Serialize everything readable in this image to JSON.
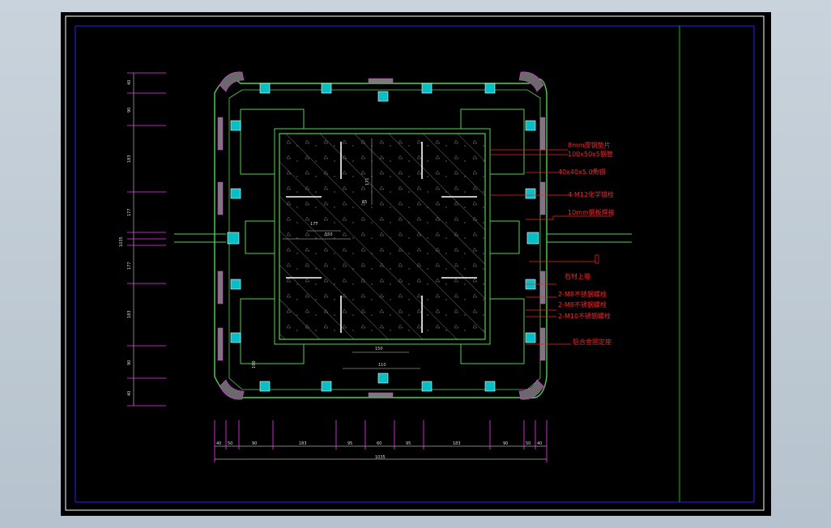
{
  "drawing": {
    "callouts": [
      "8mm厚钢垫片",
      "100x50x5钢管",
      "40x40x5.0角钢",
      "4-M12化学锚栓",
      "10mm钢板焊接",
      "石材上墙",
      "2-M8不锈钢螺栓",
      "2-M8不锈钢螺栓",
      "2-M10不锈钢螺栓",
      "铝合金固定座"
    ],
    "bottom_dims": [
      "40",
      "50",
      "90",
      "183",
      "95",
      "60",
      "95",
      "183",
      "90",
      "50",
      "40"
    ],
    "bottom_total": "1035",
    "left_dims": [
      "40",
      "90",
      "183",
      "177",
      "177",
      "183",
      "90",
      "40"
    ],
    "left_total": "1035",
    "inner_dims": [
      "177",
      "150",
      "171",
      "65",
      "150",
      "110",
      "190"
    ]
  },
  "colors": {
    "frame_blue": "#1a1ad8",
    "title_green": "#00c800",
    "outline_green": "#4bd34b",
    "dim_magenta": "#ff2cff",
    "callout_red": "#ff2020",
    "bracket_cyan": "#00e0e0"
  }
}
